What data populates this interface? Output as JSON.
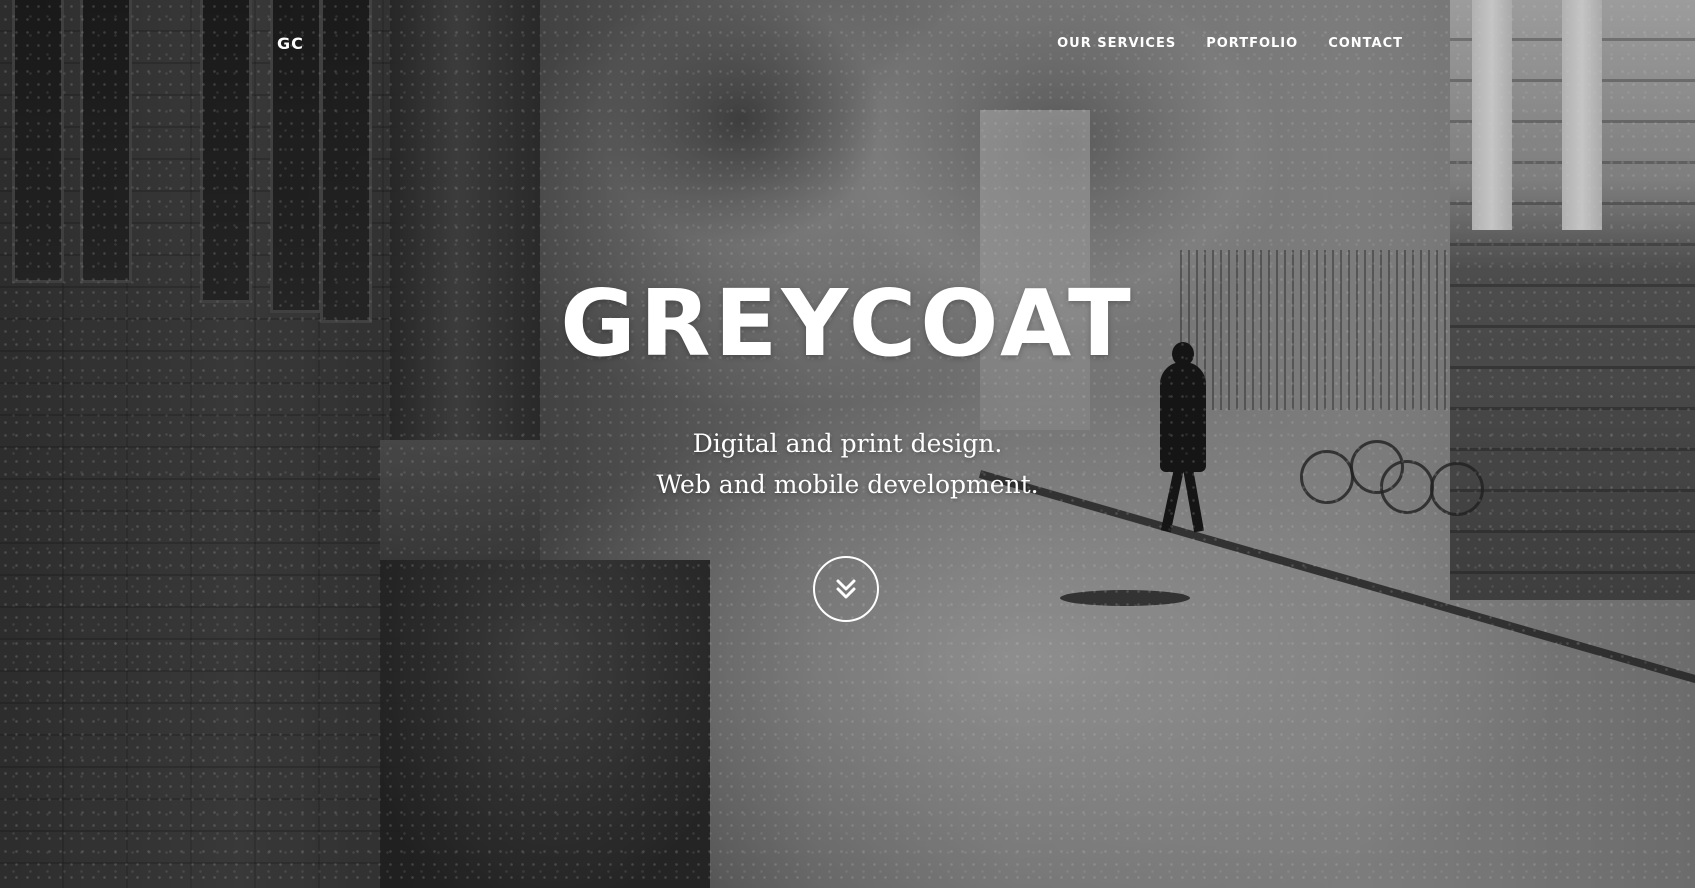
{
  "nav": {
    "brand": "GC",
    "links": [
      {
        "label": "OUR SERVICES"
      },
      {
        "label": "PORTFOLIO"
      },
      {
        "label": "CONTACT"
      }
    ]
  },
  "hero": {
    "title": "GREYCOAT",
    "subtitle_lines": [
      "Digital and print design.",
      "Web and mobile development."
    ],
    "scroll_icon": "double-chevron-down-icon",
    "background": "black-and-white photo of a rainy street with a person walking"
  },
  "colors": {
    "text": "#ffffff",
    "background": "#7a7a7a"
  }
}
